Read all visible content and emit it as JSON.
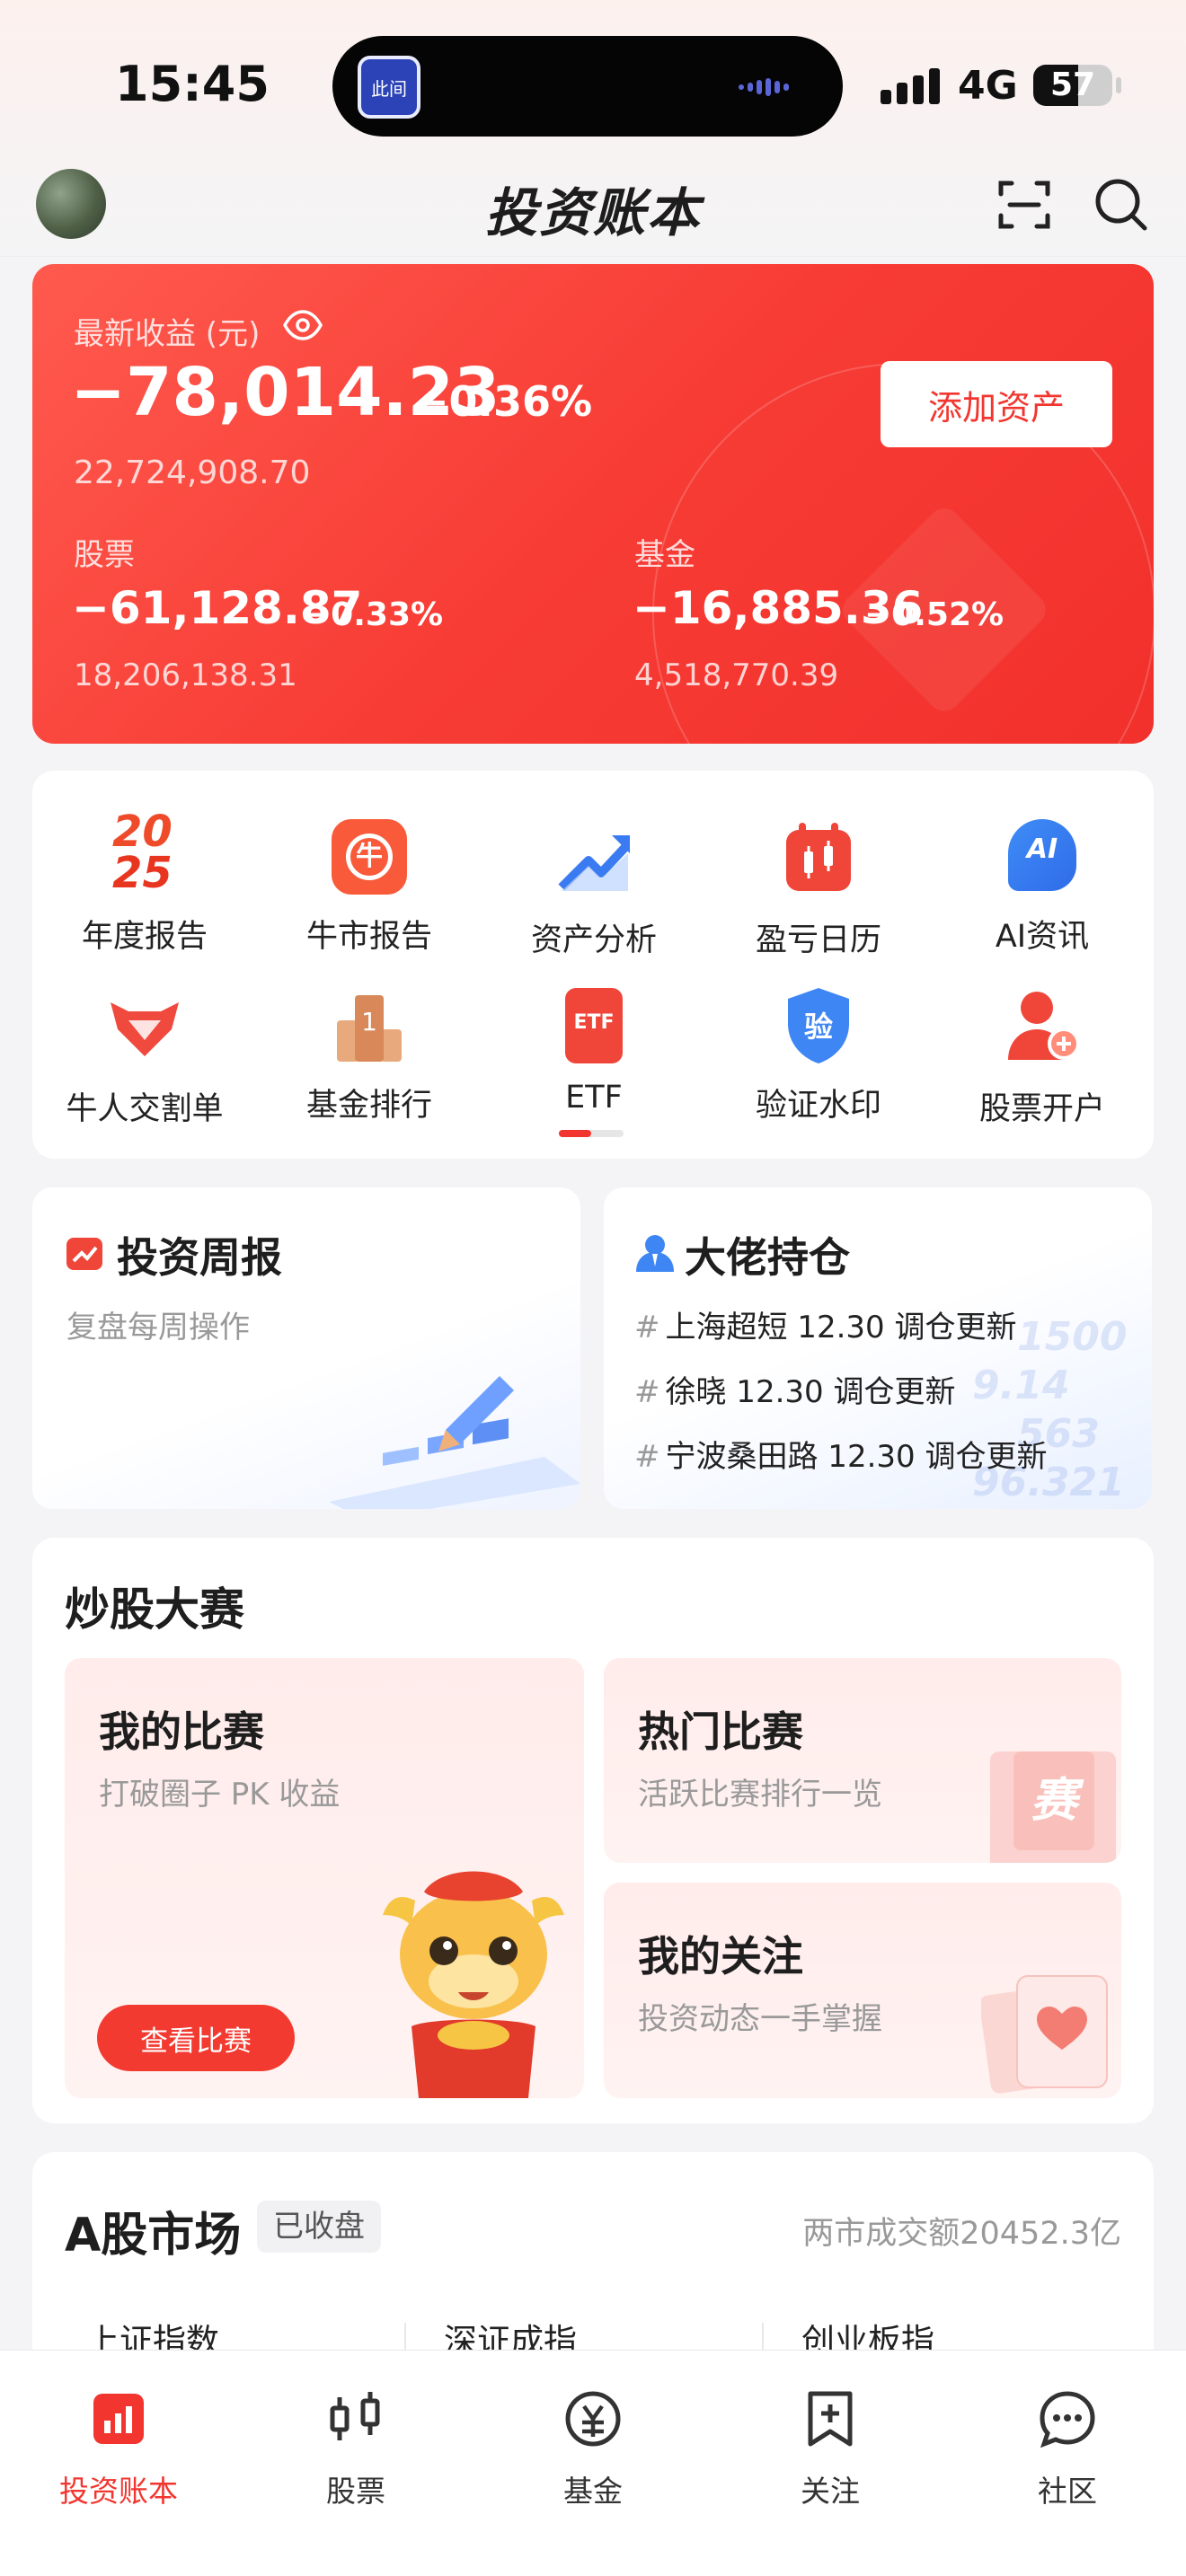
{
  "status_bar": {
    "time": "15:45",
    "network": "4G",
    "battery": "57",
    "island_app_label": "此间"
  },
  "header": {
    "title": "投资账本"
  },
  "earnings": {
    "label": "最新收益 (元)",
    "value": "−78,014.23",
    "pct": "−0.36%",
    "total": "22,724,908.70",
    "add_asset": "添加资产",
    "stocks": {
      "label": "股票",
      "value": "−61,128.87",
      "pct": "−0.33%",
      "total": "18,206,138.31"
    },
    "funds": {
      "label": "基金",
      "value": "−16,885.36",
      "pct": "−0.52%",
      "total": "4,518,770.39"
    }
  },
  "shortcuts": [
    {
      "label": "年度报告",
      "icon": "year-2025-icon"
    },
    {
      "label": "牛市报告",
      "icon": "bull-report-icon"
    },
    {
      "label": "资产分析",
      "icon": "asset-analysis-icon"
    },
    {
      "label": "盈亏日历",
      "icon": "pnl-calendar-icon"
    },
    {
      "label": "AI资讯",
      "icon": "ai-news-icon"
    },
    {
      "label": "牛人交割单",
      "icon": "expert-trades-icon"
    },
    {
      "label": "基金排行",
      "icon": "fund-ranking-icon"
    },
    {
      "label": "ETF",
      "icon": "etf-icon"
    },
    {
      "label": "验证水印",
      "icon": "verify-watermark-icon"
    },
    {
      "label": "股票开户",
      "icon": "open-account-icon"
    }
  ],
  "shortcut_icon_text": {
    "year_top": "20",
    "year_bottom": "25",
    "bull": "牛",
    "ai": "AI",
    "rank": "1",
    "etf": "ETF",
    "verify": "验"
  },
  "weekly": {
    "title": "投资周报",
    "subtitle": "复盘每周操作"
  },
  "holdings": {
    "title": "大佬持仓",
    "items": [
      "上海超短 12.30 调仓更新",
      "徐晓 12.30 调仓更新",
      "宁波桑田路 12.30 调仓更新"
    ],
    "hash": "#",
    "bg_numbers": [
      "1500",
      "9.14",
      "563",
      "96.321"
    ]
  },
  "contest": {
    "title": "炒股大赛",
    "my": {
      "title": "我的比赛",
      "subtitle": "打破圈子 PK 收益",
      "button": "查看比赛"
    },
    "hot": {
      "title": "热门比赛",
      "subtitle": "活跃比赛排行一览",
      "badge": "赛"
    },
    "follow": {
      "title": "我的关注",
      "subtitle": "投资动态一手掌握"
    }
  },
  "market": {
    "title": "A股市场",
    "status": "已收盘",
    "turnover": "两市成交额20452.3亿",
    "indices": [
      "上证指数",
      "深证成指",
      "创业板指"
    ]
  },
  "tabs": [
    {
      "label": "投资账本",
      "icon": "ledger-icon",
      "active": true
    },
    {
      "label": "股票",
      "icon": "candlestick-icon",
      "active": false
    },
    {
      "label": "基金",
      "icon": "yuan-icon",
      "active": false
    },
    {
      "label": "关注",
      "icon": "bookmark-add-icon",
      "active": false
    },
    {
      "label": "社区",
      "icon": "chat-icon",
      "active": false
    }
  ],
  "colors": {
    "accent": "#f2362f",
    "card_red": "#f73c35",
    "text_gray": "#999999"
  }
}
